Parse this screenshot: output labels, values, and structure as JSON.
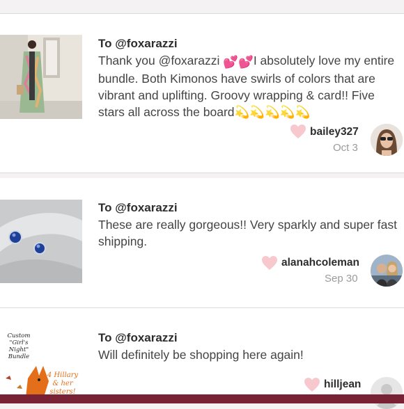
{
  "colors": {
    "heart": "#f7c9cf",
    "bottom_bar": "#7a2235",
    "accent_text": "#2d2d2d"
  },
  "reviews": [
    {
      "to": "To @foxarazzi",
      "message_part1": "Thank you @foxarazzi ",
      "message_part2": "I absolutely love my entire bundle. Both Kimonos have swirls of colors that are vibrant and uplifting. Groovy wrapping & card!! Five stars all across the board",
      "message_emojis": [
        "💕",
        "💕"
      ],
      "stars_emoji": "💫💫💫💫💫",
      "username": "bailey327",
      "date": "Oct 3"
    },
    {
      "to": "To @foxarazzi",
      "message": "These are really gorgeous!! Very sparkly and super fast shipping.",
      "username": "alanahcoleman",
      "date": "Sep 30"
    },
    {
      "to": "To @foxarazzi",
      "message": "Will definitely be shopping here again!",
      "username": "hilljean",
      "date": "",
      "thumb_text": {
        "line1": "Custom",
        "line2": "\"Girl's",
        "line3": "Night\"",
        "line4": "Bundle",
        "line5": "4 Hillary",
        "line6": "& her",
        "line7": "sisters!"
      }
    }
  ]
}
